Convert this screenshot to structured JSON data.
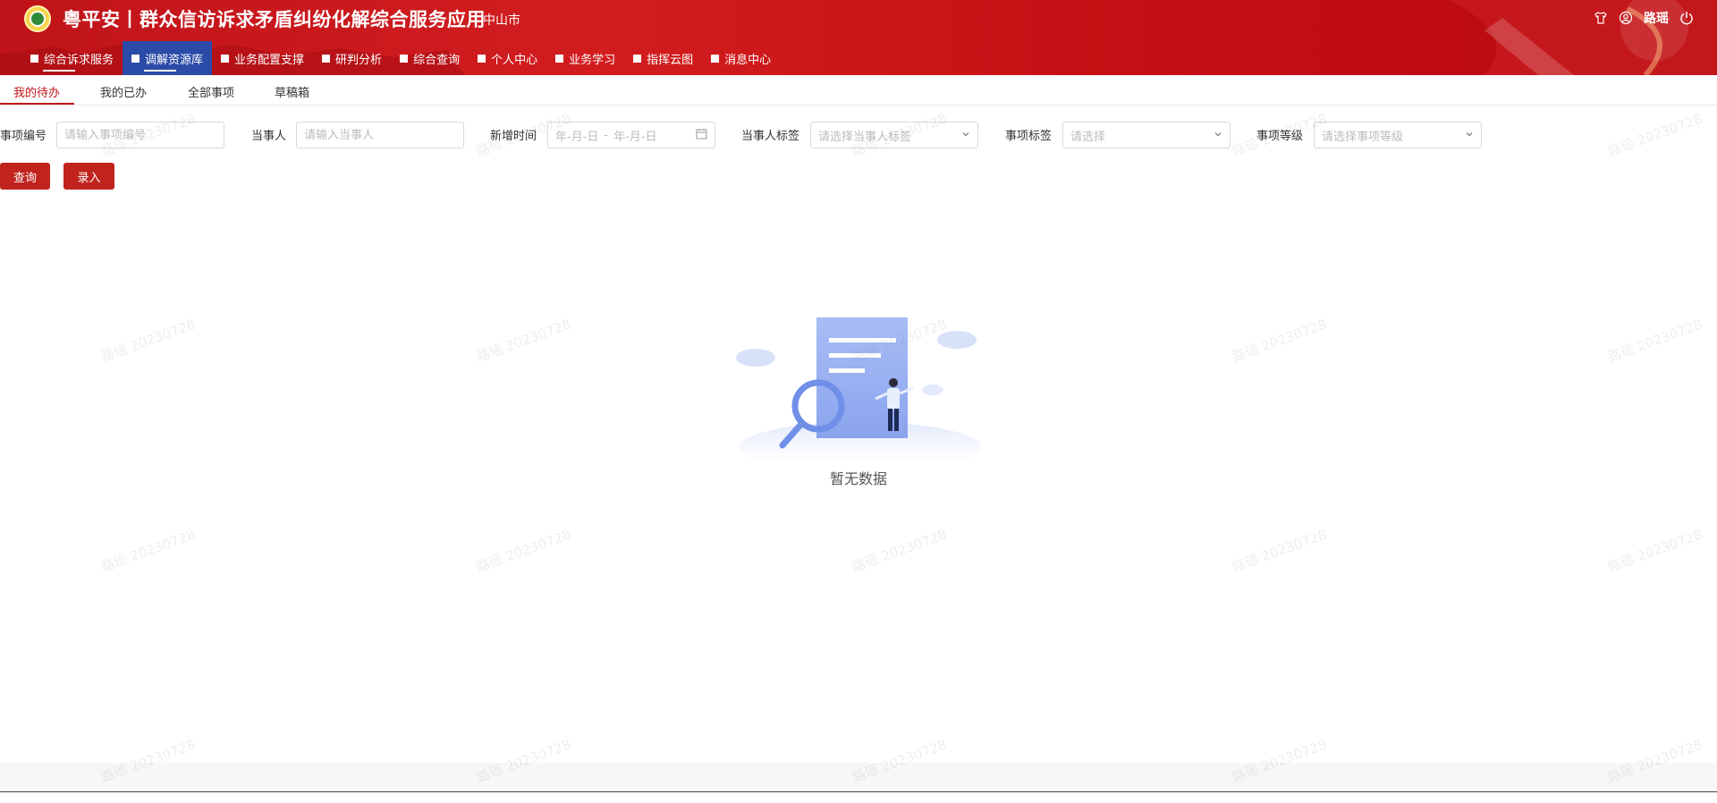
{
  "header": {
    "title": "粤平安丨群众信访诉求矛盾纠纷化解综合服务应用",
    "city": "中山市",
    "user": "路瑶",
    "icons": [
      "shirt-icon",
      "user-circle-icon",
      "power-icon"
    ]
  },
  "nav": {
    "items": [
      {
        "label": "综合诉求服务"
      },
      {
        "label": "调解资源库"
      },
      {
        "label": "业务配置支撑"
      },
      {
        "label": "研判分析"
      },
      {
        "label": "综合查询"
      },
      {
        "label": "个人中心"
      },
      {
        "label": "业务学习"
      },
      {
        "label": "指挥云图"
      },
      {
        "label": "消息中心"
      }
    ],
    "active_index": 1
  },
  "tabs": {
    "items": [
      {
        "label": "我的待办"
      },
      {
        "label": "我的已办"
      },
      {
        "label": "全部事项"
      },
      {
        "label": "草稿箱"
      }
    ],
    "active_index": 0
  },
  "filters": {
    "item_no": {
      "label": "事项编号",
      "placeholder": "请输入事项编号"
    },
    "party": {
      "label": "当事人",
      "placeholder": "请输入当事人"
    },
    "add_time": {
      "label": "新增时间",
      "start_placeholder": "年-月-日",
      "separator": "-",
      "end_placeholder": "年-月-日"
    },
    "party_tag": {
      "label": "当事人标签",
      "placeholder": "请选择当事人标签"
    },
    "item_tag": {
      "label": "事项标签",
      "placeholder": "请选择"
    },
    "item_level": {
      "label": "事项等级",
      "placeholder": "请选择事项等级"
    }
  },
  "actions": {
    "query": "查询",
    "entry": "录入"
  },
  "empty": {
    "text": "暂无数据"
  },
  "watermark": {
    "text": "路瑶 20230728"
  },
  "colors": {
    "brand_red": "#c0141a",
    "button_red": "#c0241d",
    "nav_active_blue": "#2b4ba8"
  }
}
